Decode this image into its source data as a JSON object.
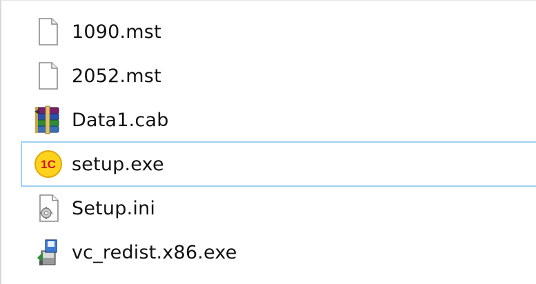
{
  "files": [
    {
      "name": "1090.mst",
      "icon": "document-icon",
      "selected": false
    },
    {
      "name": "2052.mst",
      "icon": "document-icon",
      "selected": false
    },
    {
      "name": "Data1.cab",
      "icon": "winrar-archive-icon",
      "selected": false
    },
    {
      "name": "setup.exe",
      "icon": "1c-setup-icon",
      "selected": true
    },
    {
      "name": "Setup.ini",
      "icon": "settings-file-icon",
      "selected": false
    },
    {
      "name": "vc_redist.x86.exe",
      "icon": "installer-icon",
      "selected": false
    }
  ],
  "colors": {
    "selection_border": "#9fd2f2",
    "text": "#111111",
    "background": "#ffffff"
  }
}
